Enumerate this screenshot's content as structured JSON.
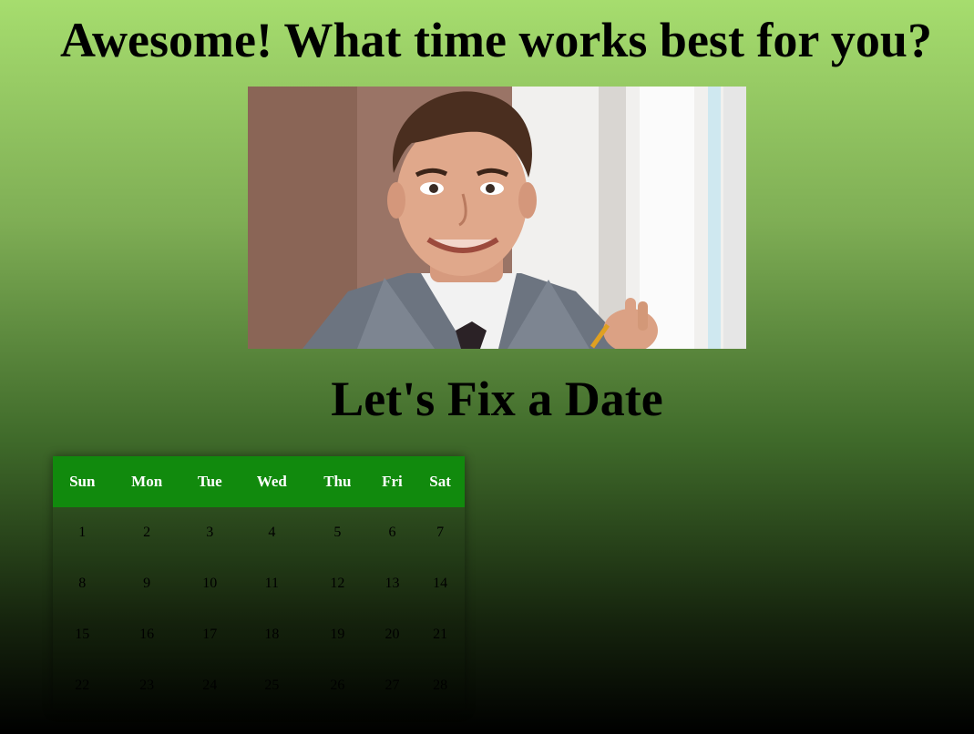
{
  "page": {
    "headline": "Awesome! What time works best for you?",
    "subheading": "Let's Fix a Date"
  },
  "calendar": {
    "weekdays": [
      "Sun",
      "Mon",
      "Tue",
      "Wed",
      "Thu",
      "Fri",
      "Sat"
    ],
    "weeks": [
      [
        "1",
        "2",
        "3",
        "4",
        "5",
        "6",
        "7"
      ],
      [
        "8",
        "9",
        "10",
        "11",
        "12",
        "13",
        "14"
      ],
      [
        "15",
        "16",
        "17",
        "18",
        "19",
        "20",
        "21"
      ],
      [
        "22",
        "23",
        "24",
        "25",
        "26",
        "27",
        "28"
      ]
    ],
    "header_color": "#118a0d"
  },
  "colors": {
    "background_top": "#a6dd6e",
    "background_bottom": "#000000"
  }
}
